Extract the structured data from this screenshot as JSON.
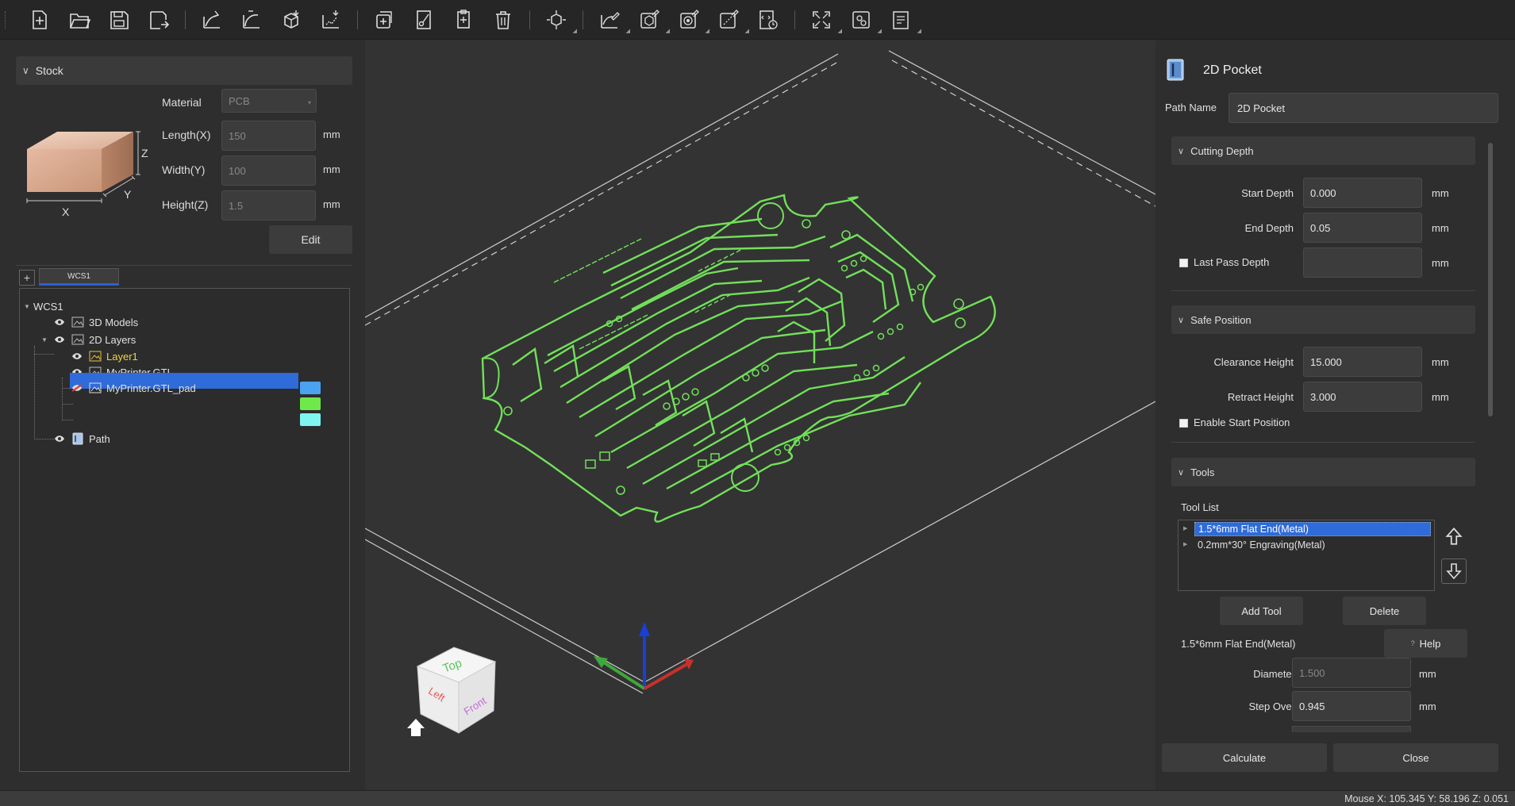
{
  "toolbar": {
    "groups": [
      [
        "new-file-icon",
        "open-folder-icon",
        "save-icon",
        "save-as-icon"
      ],
      [
        "import-curve-icon",
        "import-arc-icon",
        "import-model-icon",
        "import-vector-icon"
      ],
      [
        "add-icon",
        "cut-icon",
        "paste-icon",
        "delete-icon"
      ],
      [
        "transform-icon"
      ],
      [
        "sketch-edit-icon",
        "model-edit-icon",
        "toolpath-icon",
        "simulate-icon",
        "gcode-icon"
      ],
      [
        "fit-view-icon",
        "machine-settings-icon",
        "report-icon"
      ]
    ]
  },
  "stock": {
    "header": "Stock",
    "material_label": "Material",
    "material_value": "PCB",
    "length_label": "Length(X)",
    "length_value": "150",
    "width_label": "Width(Y)",
    "width_value": "100",
    "height_label": "Height(Z)",
    "height_value": "1.5",
    "unit": "mm",
    "edit_label": "Edit",
    "axis_x": "X",
    "axis_y": "Y",
    "axis_z": "Z"
  },
  "tree": {
    "tab": "WCS1",
    "add": "+",
    "root": "WCS1",
    "items": [
      {
        "label": "3D Models"
      },
      {
        "label": "2D Layers"
      },
      {
        "label": "Layer1",
        "color": "#4aa3f0"
      },
      {
        "label": "MyPrinter.GTL",
        "color": "#6ee84a"
      },
      {
        "label": "MyPrinter.GTL_pad",
        "color": "#7ff5f2"
      },
      {
        "label": "Path"
      }
    ]
  },
  "viewcube": {
    "top": "Top",
    "left": "Left",
    "front": "Front"
  },
  "panel": {
    "title": "2D Pocket",
    "path_name_label": "Path Name",
    "path_name_value": "2D Pocket",
    "cutting_depth": {
      "header": "Cutting Depth",
      "start_label": "Start Depth",
      "start_value": "0.000",
      "end_label": "End Depth",
      "end_value": "0.05",
      "last_pass_label": "Last Pass Depth",
      "last_pass_value": ""
    },
    "safe_position": {
      "header": "Safe Position",
      "clearance_label": "Clearance Height",
      "clearance_value": "15.000",
      "retract_label": "Retract Height",
      "retract_value": "3.000",
      "enable_start_label": "Enable Start Position"
    },
    "tools": {
      "header": "Tools",
      "list_label": "Tool List",
      "items": [
        "1.5*6mm Flat End(Metal)",
        "0.2mm*30° Engraving(Metal)"
      ],
      "add_label": "Add Tool",
      "delete_label": "Delete",
      "selected_tool": "1.5*6mm Flat End(Metal)",
      "help_label": "Help",
      "help_icon": "?",
      "diameter_label": "Diameter",
      "diameter_value": "1.500",
      "stepover_label": "Step Over",
      "stepover_value": "0.945"
    },
    "unit": "mm",
    "calculate_label": "Calculate",
    "close_label": "Close"
  },
  "status": {
    "mouse": "Mouse X: 105.345 Y: 58.196 Z: 0.051"
  },
  "colors": {
    "pcb_trace": "#72e05a",
    "selection": "#2f6bd9",
    "axis_x": "#c8302c",
    "axis_y": "#3fa83a",
    "axis_z": "#1a3fd6"
  }
}
